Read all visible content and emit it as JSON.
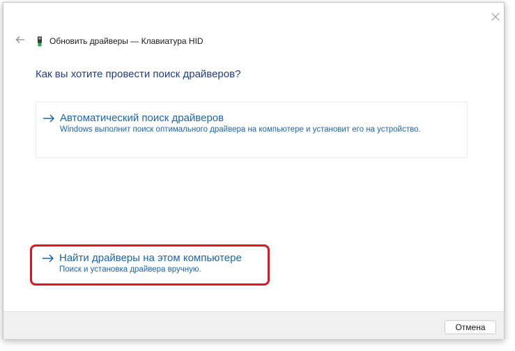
{
  "window": {
    "title": "Обновить драйверы — Клавиатура HID",
    "icons": {
      "close": "close-icon",
      "back": "back-arrow-icon",
      "device": "keyboard-device-icon"
    }
  },
  "main": {
    "question": "Как вы хотите провести поиск драйверов?",
    "options": [
      {
        "title": "Автоматический поиск драйверов",
        "description": "Windows выполнит поиск оптимального драйвера на компьютере и установит его на устройство.",
        "icon": "arrow-right-icon"
      },
      {
        "title": "Найти драйверы на этом компьютере",
        "description": "Поиск и установка драйвера вручную.",
        "icon": "arrow-right-icon",
        "highlighted": true
      }
    ]
  },
  "footer": {
    "cancel_label": "Отмена"
  },
  "colors": {
    "link": "#1964b9",
    "heading": "#1f3a93",
    "highlight": "#e8121a",
    "footer_bg": "#f0f0f0"
  }
}
